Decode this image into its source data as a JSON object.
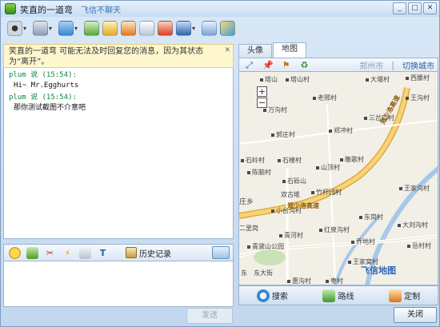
{
  "window": {
    "title": "笑直的一道弯",
    "status": "飞信不聊天"
  },
  "warning": {
    "text": "笑直的一道弯 可能无法及时回复您的消息，因为其状态为“离开”。"
  },
  "chat": {
    "messages": [
      {
        "header": "plum 说 (15:54):",
        "body": "Hi~ Mr.Egghurts"
      },
      {
        "header": "plum 说 (15:54):",
        "body": "那你测试截图不介意吧"
      }
    ]
  },
  "input_toolbar": {
    "history_label": "历史记录"
  },
  "send_button": "发送",
  "tabs": [
    {
      "label": "头像"
    },
    {
      "label": "地图"
    }
  ],
  "map_toolbar": {
    "city": "郑州市",
    "switch_city": "切换城市"
  },
  "map": {
    "zoom_in": "+",
    "zoom_out": "−",
    "labels": [
      "塔山",
      "塔山村",
      "大堰村",
      "西腰村",
      "老邢村",
      "王沟村",
      "万沟村",
      "三岔口村",
      "郭庄村",
      "郑冲村",
      "石岭村",
      "石楼村",
      "山顶村",
      "皦歌村",
      "陈脑村",
      "石砾山",
      "王家沟村",
      "双古堆",
      "竹杆园村",
      "庄乡",
      "小台沟村",
      "东岗村",
      "青河村",
      "红泉沟村",
      "二里岗",
      "大刘沟村",
      "青黛山公园",
      "乔地村",
      "岳村村",
      "东大街",
      "惠沟村",
      "王家窝村",
      "东",
      "枣村"
    ],
    "highway": "郑少洛高速",
    "brand": "飞信地图"
  },
  "map_actions": {
    "search": "搜索",
    "route": "路线",
    "custom": "定制"
  },
  "close_button": "关闭"
}
